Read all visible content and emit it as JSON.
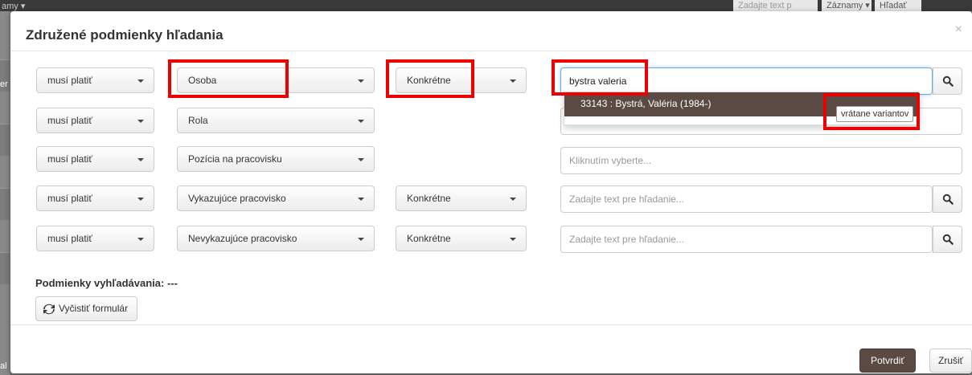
{
  "background": {
    "top_left_fragment": "amy ▾",
    "top_right": {
      "search_placeholder": "Zadajte text p",
      "records_label": "Záznamy ▾",
      "search_label": "Hľadať"
    },
    "left_fragment_1": "er",
    "left_fragment_2": "al"
  },
  "modal": {
    "title": "Združené podmienky hľadania",
    "close_label": "×"
  },
  "rows": [
    {
      "must": "musí platiť",
      "field": "Osoba",
      "type": "Konkrétne",
      "value": "bystra valeria"
    },
    {
      "must": "musí platiť",
      "field": "Rola"
    },
    {
      "must": "musí platiť",
      "field": "Pozícia na pracovisku",
      "placeholder": "Kliknutím vyberte..."
    },
    {
      "must": "musí platiť",
      "field": "Vykazujúce pracovisko",
      "type": "Konkrétne",
      "placeholder": "Zadajte text pre hľadanie..."
    },
    {
      "must": "musí platiť",
      "field": "Nevykazujúce pracovisko",
      "type": "Konkrétne",
      "placeholder": "Zadajte text pre hľadanie..."
    }
  ],
  "autocomplete": {
    "item": "33143 : Bystrá, Valéria (1984-)",
    "variants_button": "vrátane variantov"
  },
  "conditions": {
    "label": "Podmienky vyhľadávania:",
    "value": "---"
  },
  "buttons": {
    "clear": "Vyčistiť formulár",
    "confirm": "Potvrdiť",
    "cancel": "Zrušiť"
  },
  "colors": {
    "accent": "#5b4a43",
    "highlight_box": "#e00000",
    "focus": "#66afe9"
  }
}
